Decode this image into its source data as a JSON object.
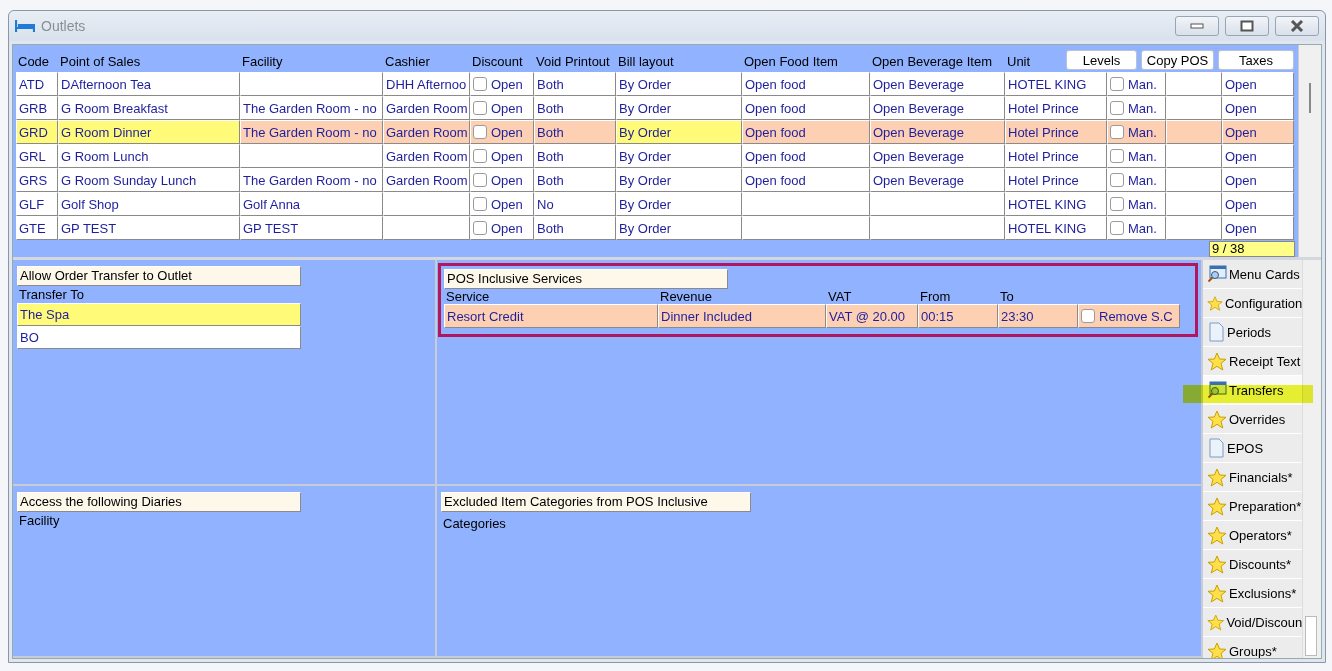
{
  "window": {
    "title": "Outlets"
  },
  "table": {
    "columns": [
      "Code",
      "Point of Sales",
      "Facility",
      "Cashier",
      "Discount",
      "Void Printout",
      "Bill layout",
      "Open Food Item",
      "Open Beverage Item",
      "Unit"
    ],
    "header_buttons": [
      "Levels",
      "Copy POS",
      "Taxes"
    ],
    "rows": [
      {
        "selected": false,
        "code": "ATD",
        "point_of_sales": "DAfternoon Tea",
        "cashier": "DHH Afternoo",
        "discount": {
          "checked": false,
          "label": "Open"
        },
        "void_printout": "Both",
        "bill_layout": "By Order",
        "open_food_item": "Open food",
        "open_beverage_item": "Open Beverage",
        "unit": "HOTEL KING",
        "column_11": {
          "checked": false,
          "label": "Man."
        },
        "taxes": "Open"
      },
      {
        "selected": false,
        "code": "GRB",
        "point_of_sales": "G Room Breakfast",
        "facility": "The Garden Room - no",
        "cashier": "Garden Room",
        "discount": {
          "checked": false,
          "label": "Open"
        },
        "void_printout": "Both",
        "bill_layout": "By Order",
        "open_food_item": "Open food",
        "open_beverage_item": "Open Beverage",
        "unit": "Hotel Prince",
        "column_11": {
          "checked": false,
          "label": "Man."
        },
        "taxes": "Open"
      },
      {
        "selected": true,
        "code": "GRD",
        "point_of_sales": "G Room Dinner",
        "facility": "The Garden Room - no",
        "cashier": "Garden Room",
        "discount": {
          "checked": false,
          "label": "Open"
        },
        "void_printout": "Both",
        "bill_layout": "By Order",
        "open_food_item": "Open food",
        "open_beverage_item": "Open Beverage",
        "unit": "Hotel Prince",
        "column_11": {
          "checked": false,
          "label": "Man."
        },
        "taxes": "Open"
      },
      {
        "selected": false,
        "code": "GRL",
        "point_of_sales": "G Room Lunch",
        "cashier": "Garden Room",
        "discount": {
          "checked": false,
          "label": "Open"
        },
        "void_printout": "Both",
        "bill_layout": "By Order",
        "open_food_item": "Open food",
        "open_beverage_item": "Open Beverage",
        "unit": "Hotel Prince",
        "column_11": {
          "checked": false,
          "label": "Man."
        },
        "taxes": "Open"
      },
      {
        "selected": false,
        "code": "GRS",
        "point_of_sales": "G Room Sunday Lunch",
        "facility": "The Garden Room - no",
        "cashier": "Garden Room",
        "discount": {
          "checked": false,
          "label": "Open"
        },
        "void_printout": "Both",
        "bill_layout": "By Order",
        "open_food_item": "Open food",
        "open_beverage_item": "Open Beverage",
        "unit": "Hotel Prince",
        "column_11": {
          "checked": false,
          "label": "Man."
        },
        "taxes": "Open"
      },
      {
        "selected": false,
        "code": "GLF",
        "point_of_sales": "Golf Shop",
        "facility": "Golf Anna",
        "discount": {
          "checked": false,
          "label": "Open"
        },
        "void_printout": "No",
        "bill_layout": "By Order",
        "unit": "HOTEL KING",
        "column_11": {
          "checked": false,
          "label": "Man."
        },
        "taxes": "Open"
      },
      {
        "selected": false,
        "code": "GTE",
        "point_of_sales": "GP TEST",
        "facility": "GP TEST",
        "discount": {
          "checked": false,
          "label": "Open"
        },
        "void_printout": "Both",
        "bill_layout": "By Order",
        "unit": "HOTEL KING",
        "column_11": {
          "checked": false,
          "label": "Man."
        },
        "taxes": "Open"
      }
    ],
    "position": "9 / 38"
  },
  "transfers": {
    "title": "Allow Order Transfer to Outlet",
    "label": "Transfer To",
    "items": [
      {
        "text": "The Spa",
        "selected": true
      },
      {
        "text": "BO",
        "selected": false
      }
    ]
  },
  "inclusive_services": {
    "title": "POS Inclusive Services",
    "annotated": true,
    "columns": [
      "Service",
      "Revenue",
      "VAT",
      "From",
      "To"
    ],
    "rows": [
      {
        "selected": true,
        "service": "Resort Credit",
        "revenue": "Dinner Included",
        "vat": "VAT @ 20.00",
        "from": "00:15",
        "to": "23:30",
        "remove_sc": {
          "checked": false,
          "label": "Remove S.C"
        }
      }
    ]
  },
  "diaries": {
    "title": "Access the following Diaries",
    "label": "Facility"
  },
  "excluded_categories": {
    "title": "Excluded Item Categories from POS Inclusive",
    "label": "Categories"
  },
  "sidebar": {
    "items": [
      {
        "kind": "card",
        "label": "Menu Cards",
        "selected": false,
        "highlighted": false
      },
      {
        "kind": "star",
        "label": "Configuration",
        "selected": false,
        "highlighted": false
      },
      {
        "kind": "page",
        "label": "Periods",
        "selected": false,
        "highlighted": false
      },
      {
        "kind": "star",
        "label": "Receipt Text",
        "selected": false,
        "highlighted": false
      },
      {
        "kind": "card",
        "label": "Transfers",
        "selected": true,
        "highlighted": true
      },
      {
        "kind": "star",
        "label": "Overrides",
        "selected": false,
        "highlighted": false
      },
      {
        "kind": "page",
        "label": "EPOS",
        "selected": false,
        "highlighted": false
      },
      {
        "kind": "star",
        "label": "Financials*",
        "selected": false,
        "highlighted": false
      },
      {
        "kind": "star",
        "label": "Preparation*",
        "selected": false,
        "highlighted": false
      },
      {
        "kind": "star",
        "label": "Operators*",
        "selected": false,
        "highlighted": false
      },
      {
        "kind": "star",
        "label": "Discounts*",
        "selected": false,
        "highlighted": false
      },
      {
        "kind": "star",
        "label": "Exclusions*",
        "selected": false,
        "highlighted": false
      },
      {
        "kind": "star",
        "label": "Void/Discoun",
        "selected": false,
        "highlighted": false
      },
      {
        "kind": "star",
        "label": "Groups*",
        "selected": false,
        "highlighted": false
      }
    ]
  }
}
